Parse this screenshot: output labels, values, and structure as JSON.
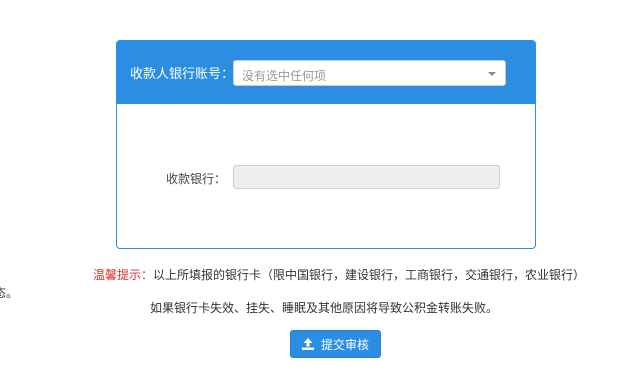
{
  "panel": {
    "account_label": "收款人银行账号：",
    "account_select": {
      "value": "没有选中任何项",
      "caret_icon": "caret-down-icon"
    },
    "bank_label": "收款银行：",
    "bank_value": ""
  },
  "notice": {
    "warning_label": "温馨提示：",
    "line1": "以上所填报的银行卡（限中国银行，建设银行，工商银行，交通银行，农业银行）",
    "line2": "如果银行卡失效、挂失、睡眠及其他原因将导致公积金转账失败。"
  },
  "edge_text": "态。",
  "submit": {
    "label": "提交审核",
    "icon": "upload-icon"
  },
  "colors": {
    "primary": "#2b8ee3",
    "warning": "#d9332b"
  }
}
